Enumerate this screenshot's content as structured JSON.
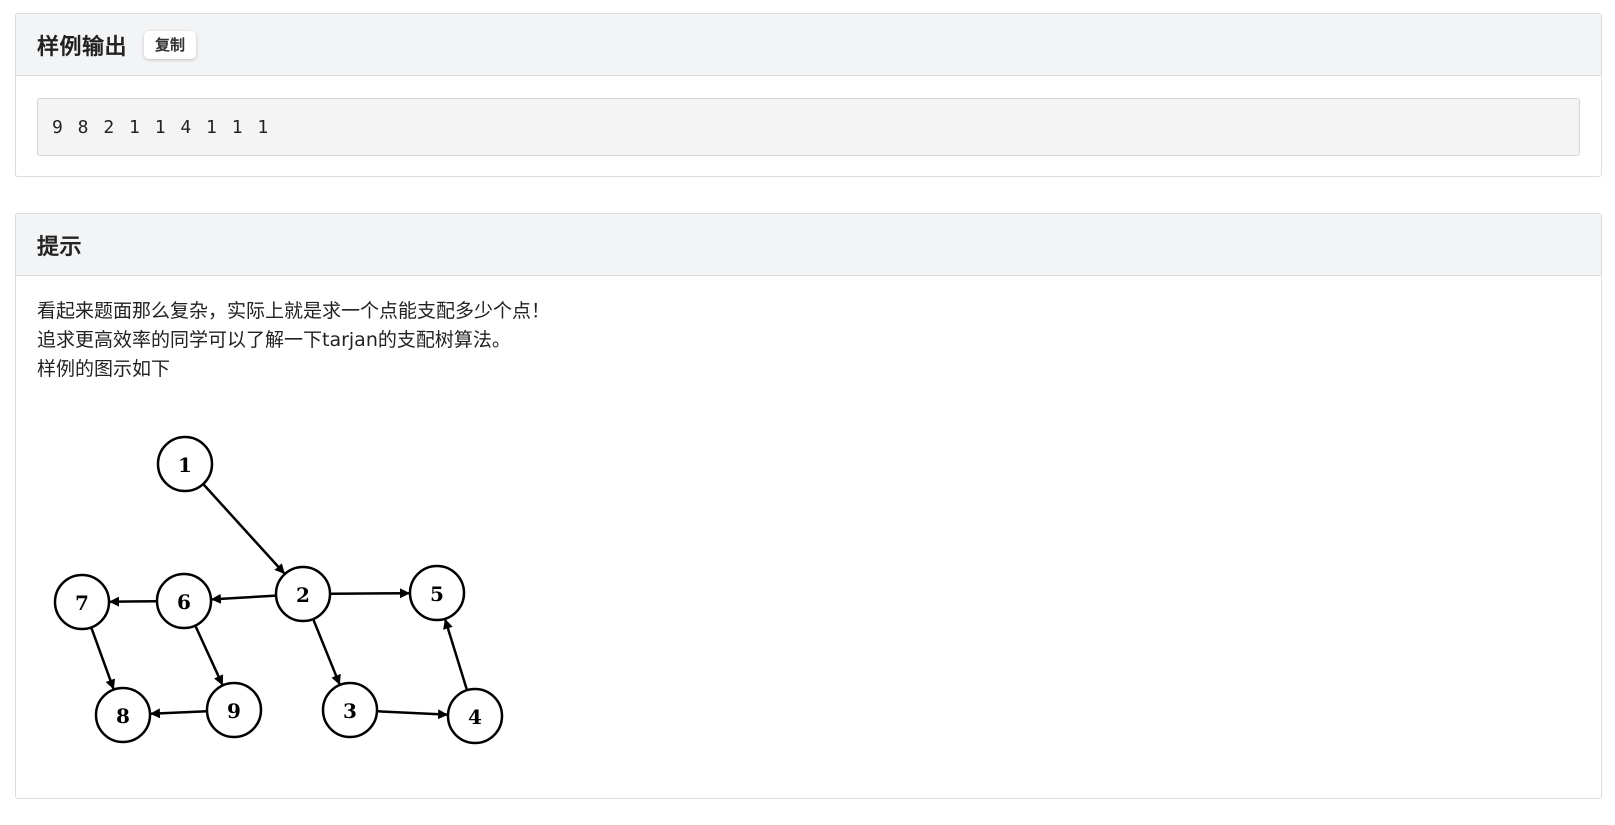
{
  "sample_output": {
    "title": "样例输出",
    "copy_label": "复制",
    "content": "9 8 2 1 1 4 1 1 1"
  },
  "hint": {
    "title": "提示",
    "lines": [
      "看起来题面那么复杂，实际上就是求一个点能支配多少个点！",
      "追求更高效率的同学可以了解一下tarjan的支配树算法。",
      "样例的图示如下"
    ]
  },
  "graph": {
    "nodes": [
      "1",
      "2",
      "3",
      "4",
      "5",
      "6",
      "7",
      "8",
      "9"
    ],
    "edges": [
      [
        "1",
        "2"
      ],
      [
        "2",
        "5"
      ],
      [
        "2",
        "6"
      ],
      [
        "2",
        "3"
      ],
      [
        "6",
        "7"
      ],
      [
        "6",
        "9"
      ],
      [
        "7",
        "8"
      ],
      [
        "9",
        "8"
      ],
      [
        "3",
        "4"
      ],
      [
        "4",
        "5"
      ]
    ]
  }
}
